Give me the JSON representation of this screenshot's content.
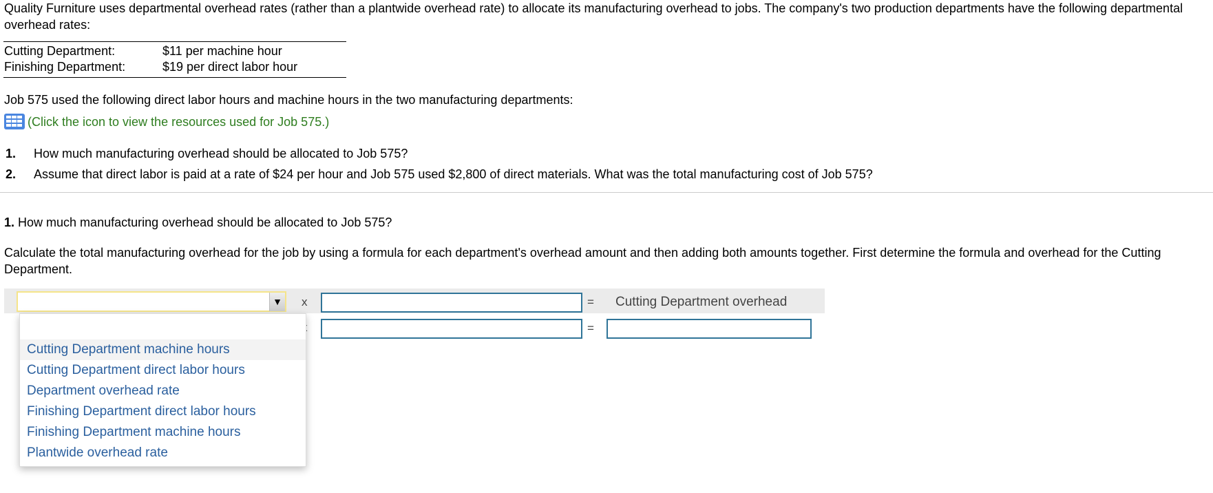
{
  "intro": "Quality Furniture uses departmental overhead rates (rather than a plantwide overhead rate) to allocate its manufacturing overhead to jobs. The company's two production departments have the following departmental overhead rates:",
  "rates": [
    {
      "dept": "Cutting Department:",
      "rate": "$11 per machine hour"
    },
    {
      "dept": "Finishing Department:",
      "rate": "$19 per direct labor hour"
    }
  ],
  "job_text": "Job 575 used the following direct labor hours and machine hours in the two manufacturing departments:",
  "resource_link": {
    "icon": "table-grid-icon",
    "label": "(Click the icon to view the resources used for Job 575.)",
    "color": "#2e7d1f"
  },
  "questions": [
    {
      "num": "1.",
      "text": "How much manufacturing overhead should be allocated to Job 575?"
    },
    {
      "num": "2.",
      "text": "Assume that direct labor is paid at a rate of $24 per hour and Job 575 used $2,800 of direct materials. What was the total manufacturing cost of Job 575?"
    }
  ],
  "part1": {
    "num": "1.",
    "heading": "How much manufacturing overhead should be allocated to Job 575?",
    "instructions": "Calculate the total manufacturing overhead for the job by using a formula for each department's overhead amount and then adding both amounts together. First determine the formula and overhead for the Cutting Department."
  },
  "formula": {
    "times": "x",
    "equals": "=",
    "result_label": "Cutting Department overhead",
    "select_value": "",
    "input1_value": "",
    "input2_value": "",
    "input3_value": ""
  },
  "dropdown_options": [
    "",
    "Cutting Department machine hours",
    "Cutting Department direct labor hours",
    "Department overhead rate",
    "Finishing Department direct labor hours",
    "Finishing Department machine hours",
    "Plantwide overhead rate"
  ],
  "colors": {
    "option_text": "#2a5f9e",
    "input_border": "#2f7498",
    "select_focus": "#f5e48a"
  }
}
